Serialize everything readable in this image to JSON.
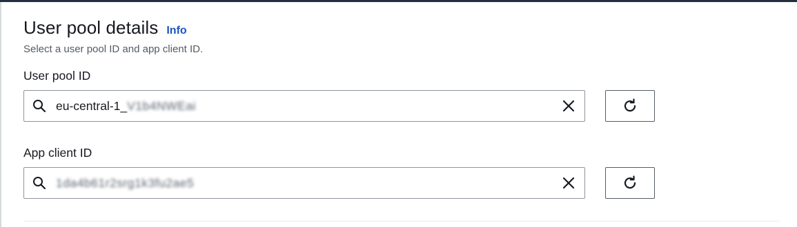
{
  "section": {
    "title": "User pool details",
    "info_label": "Info",
    "description": "Select a user pool ID and app client ID."
  },
  "user_pool": {
    "label": "User pool ID",
    "value_prefix": "eu-central-1_",
    "value_blurred": "V1b4NWEai"
  },
  "app_client": {
    "label": "App client ID",
    "value_blurred": "1da4b61r2srg1k3fu2ae5"
  },
  "icons": {
    "search": "search-icon",
    "clear": "close-icon",
    "refresh": "refresh-icon"
  },
  "colors": {
    "info_link": "#1c52c5",
    "border": "#8d949c",
    "text": "#16191f"
  }
}
